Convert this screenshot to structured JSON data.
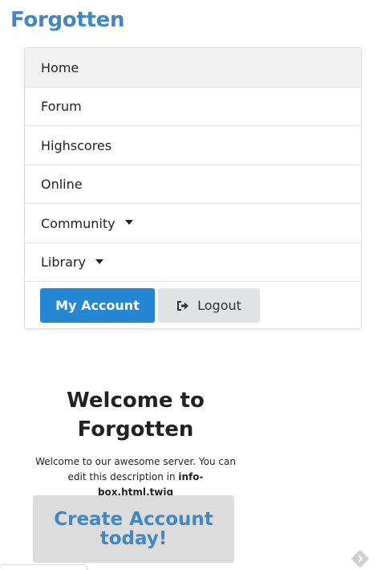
{
  "site": {
    "brand": "Forgotten"
  },
  "nav": {
    "items": [
      {
        "label": "Home",
        "active": true,
        "dropdown": false
      },
      {
        "label": "Forum",
        "active": false,
        "dropdown": false
      },
      {
        "label": "Highscores",
        "active": false,
        "dropdown": false
      },
      {
        "label": "Online",
        "active": false,
        "dropdown": false
      },
      {
        "label": "Community",
        "active": false,
        "dropdown": true
      },
      {
        "label": "Library",
        "active": false,
        "dropdown": true
      }
    ],
    "my_account_label": "My Account",
    "logout_label": "Logout"
  },
  "welcome": {
    "title_line1": "Welcome to",
    "title_line2": "Forgotten",
    "text_prefix": "Welcome to our awesome server. You can edit this description in ",
    "text_file": "info-box.html.twig",
    "cta_label": "Create Account today!"
  },
  "colors": {
    "brand": "#3f88c5",
    "primary_button": "#2587d3",
    "secondary_button": "#e1e2e4",
    "cta_background": "#dcdcdc"
  }
}
